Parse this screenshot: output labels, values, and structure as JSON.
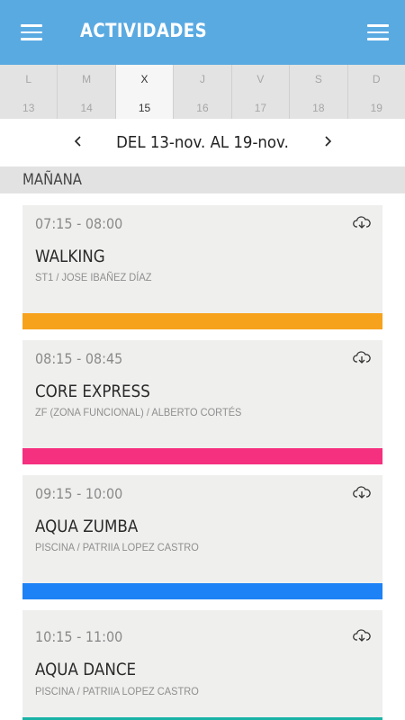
{
  "appbar": {
    "title": "ACTIVIDADES"
  },
  "days": [
    {
      "letter": "L",
      "num": "13",
      "selected": false
    },
    {
      "letter": "M",
      "num": "14",
      "selected": false
    },
    {
      "letter": "X",
      "num": "15",
      "selected": true
    },
    {
      "letter": "J",
      "num": "16",
      "selected": false
    },
    {
      "letter": "V",
      "num": "17",
      "selected": false
    },
    {
      "letter": "S",
      "num": "18",
      "selected": false
    },
    {
      "letter": "D",
      "num": "19",
      "selected": false
    }
  ],
  "week": {
    "label": "DEL 13-nov. AL 19-nov."
  },
  "section": {
    "title": "MAÑANA"
  },
  "activities": [
    {
      "time": "07:15 - 08:00",
      "title": "WALKING",
      "subtitle": "ST1 / JOSE IBAÑEZ DÍAZ",
      "color": "#f6a21d"
    },
    {
      "time": "08:15 - 08:45",
      "title": "CORE EXPRESS",
      "subtitle": "ZF (ZONA FUNCIONAL) / ALBERTO CORTÉS",
      "color": "#f5307f"
    },
    {
      "time": "09:15 - 10:00",
      "title": "AQUA ZUMBA",
      "subtitle": "PISCINA / PATRIIA LOPEZ CASTRO",
      "color": "#1d82f5"
    },
    {
      "time": "10:15 - 11:00",
      "title": "AQUA DANCE",
      "subtitle": "PISCINA / PATRIIA LOPEZ CASTRO",
      "color": "#19b3a6"
    }
  ],
  "icons": {
    "menu_left": "hamburger-menu-icon",
    "menu_right": "hamburger-menu-icon",
    "prev_week": "chevron-left-icon",
    "next_week": "chevron-right-icon",
    "card_action": "cloud-download-icon"
  }
}
